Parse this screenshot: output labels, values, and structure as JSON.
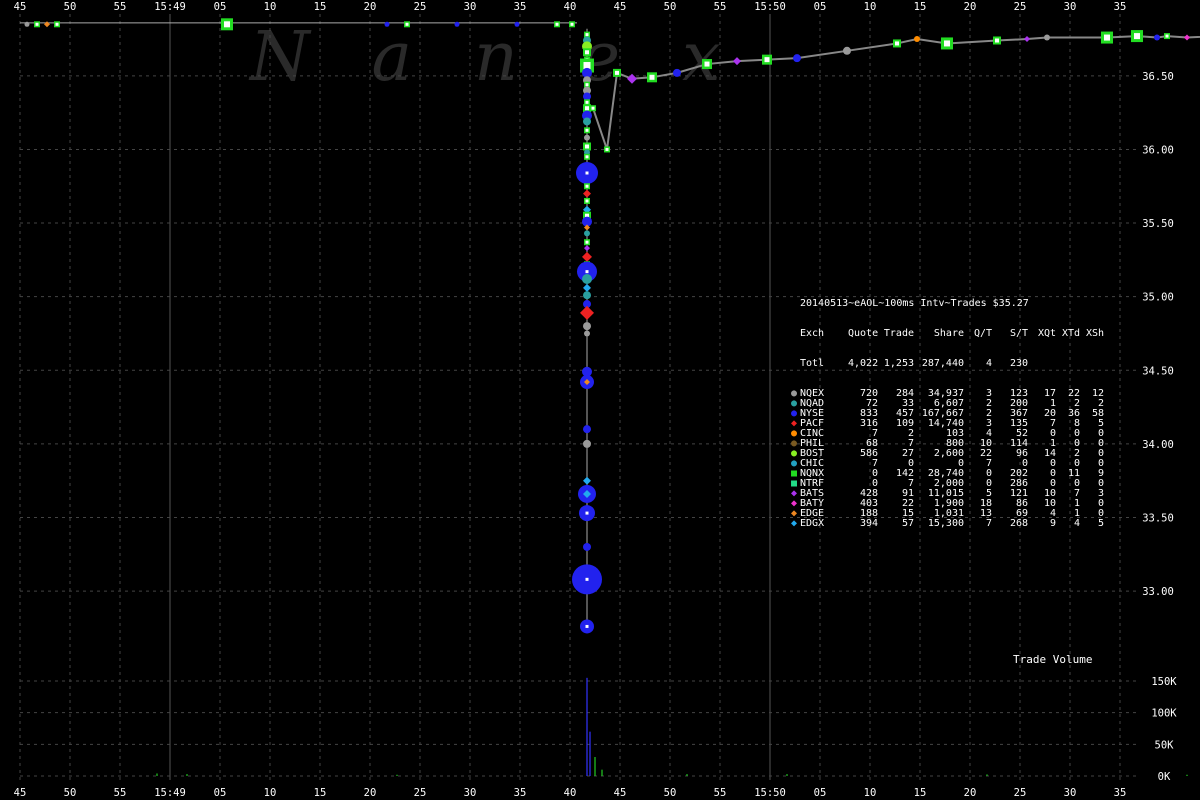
{
  "chart_data": {
    "type": "scatter",
    "title": "20140513~eAOL~100ms Intv~Trades $35.27",
    "watermark": "Nanex",
    "x_tick_labels": [
      "45",
      "50",
      "55",
      "15:49",
      "05",
      "10",
      "15",
      "20",
      "25",
      "30",
      "35",
      "40",
      "45",
      "50",
      "55",
      "15:50",
      "05",
      "10",
      "15",
      "20",
      "25",
      "30",
      "35"
    ],
    "y_price_ticks": [
      "36.50",
      "36.00",
      "35.50",
      "35.00",
      "34.50",
      "34.00",
      "33.50",
      "33.00"
    ],
    "y_price_range": [
      32.6,
      36.92
    ],
    "y_volume_ticks": [
      "150K",
      "100K",
      "50K",
      "0K"
    ],
    "volume_label": "Trade Volume",
    "grid": true,
    "legend_placement": "right-middle",
    "table": {
      "header": [
        "Exch",
        "Quote",
        "Trade",
        "Share",
        "Q/T",
        "S/T",
        "XQt",
        "XTd",
        "XSh"
      ],
      "totals": [
        "Totl",
        "4,022",
        "1,253",
        "287,440",
        "4",
        "230",
        "",
        "",
        ""
      ],
      "rows": [
        {
          "name": "NQEX",
          "color": "#9a9a9a",
          "marker": "circle",
          "values": [
            "720",
            "284",
            "34,937",
            "3",
            "123",
            "17",
            "22",
            "12"
          ]
        },
        {
          "name": "NQAD",
          "color": "#2aa0a0",
          "marker": "small-circle",
          "values": [
            "72",
            "33",
            "6,607",
            "2",
            "200",
            "1",
            "2",
            "2"
          ]
        },
        {
          "name": "NYSE",
          "color": "#2222ee",
          "marker": "big-circle",
          "values": [
            "833",
            "457",
            "167,667",
            "2",
            "367",
            "20",
            "36",
            "58"
          ]
        },
        {
          "name": "PACF",
          "color": "#ee2222",
          "marker": "diamond",
          "values": [
            "316",
            "109",
            "14,740",
            "3",
            "135",
            "7",
            "8",
            "5"
          ]
        },
        {
          "name": "CINC",
          "color": "#ff8c00",
          "marker": "circle",
          "values": [
            "7",
            "2",
            "103",
            "4",
            "52",
            "0",
            "0",
            "0"
          ]
        },
        {
          "name": "PHIL",
          "color": "#7a5a22",
          "marker": "circle",
          "values": [
            "68",
            "7",
            "800",
            "10",
            "114",
            "1",
            "0",
            "0"
          ]
        },
        {
          "name": "BOST",
          "color": "#88ee22",
          "marker": "big-circle",
          "values": [
            "586",
            "27",
            "2,600",
            "22",
            "96",
            "14",
            "2",
            "0"
          ]
        },
        {
          "name": "CHIC",
          "color": "#22a0c0",
          "marker": "circle",
          "values": [
            "7",
            "0",
            "0",
            "7",
            "0",
            "0",
            "0",
            "0"
          ]
        },
        {
          "name": "NQNX",
          "color": "#22dd22",
          "marker": "square",
          "values": [
            "0",
            "142",
            "28,740",
            "0",
            "202",
            "0",
            "11",
            "9"
          ]
        },
        {
          "name": "NTRF",
          "color": "#22dd88",
          "marker": "square",
          "values": [
            "0",
            "7",
            "2,000",
            "0",
            "286",
            "0",
            "0",
            "0"
          ]
        },
        {
          "name": "BATS",
          "color": "#aa33ee",
          "marker": "diamond",
          "values": [
            "428",
            "91",
            "11,015",
            "5",
            "121",
            "10",
            "7",
            "3"
          ]
        },
        {
          "name": "BATY",
          "color": "#ee33cc",
          "marker": "diamond",
          "values": [
            "403",
            "22",
            "1,900",
            "18",
            "86",
            "10",
            "1",
            "0"
          ]
        },
        {
          "name": "EDGE",
          "color": "#ee8822",
          "marker": "diamond",
          "values": [
            "188",
            "15",
            "1,031",
            "13",
            "69",
            "4",
            "1",
            "0"
          ]
        },
        {
          "name": "EDGX",
          "color": "#22aaee",
          "marker": "diamond",
          "values": [
            "394",
            "57",
            "15,300",
            "7",
            "268",
            "9",
            "4",
            "5"
          ]
        }
      ]
    },
    "trades_before": [
      {
        "t": -71,
        "p": 36.86,
        "ex": "NQNX",
        "s": 2
      },
      {
        "t": -62,
        "p": 36.86,
        "ex": "NQNX",
        "s": 2
      },
      {
        "t": -60,
        "p": 36.85,
        "ex": "EDGE",
        "s": 2
      },
      {
        "t": -59,
        "p": 36.85,
        "ex": "NQNX",
        "s": 3
      },
      {
        "t": -56,
        "p": 36.85,
        "ex": "NQEX",
        "s": 2
      },
      {
        "t": -55,
        "p": 36.85,
        "ex": "NQNX",
        "s": 3
      },
      {
        "t": -54,
        "p": 36.85,
        "ex": "EDGE",
        "s": 2
      },
      {
        "t": -53,
        "p": 36.85,
        "ex": "NQNX",
        "s": 2
      },
      {
        "t": -36,
        "p": 36.85,
        "ex": "NQNX",
        "s": 6
      },
      {
        "t": -20,
        "p": 36.85,
        "ex": "NYSE",
        "s": 2
      },
      {
        "t": -18,
        "p": 36.85,
        "ex": "NQNX",
        "s": 2
      },
      {
        "t": -13,
        "p": 36.85,
        "ex": "NYSE",
        "s": 2
      },
      {
        "t": -7,
        "p": 36.85,
        "ex": "NYSE",
        "s": 2
      },
      {
        "t": -3,
        "p": 36.85,
        "ex": "NQNX",
        "s": 3
      },
      {
        "t": -1.5,
        "p": 36.85,
        "ex": "NQNX",
        "s": 3
      }
    ],
    "crash_column": [
      {
        "p": 36.78,
        "ex": "NQNX",
        "s": 3
      },
      {
        "p": 36.74,
        "ex": "NQAD",
        "s": 4
      },
      {
        "p": 36.7,
        "ex": "BOST",
        "s": 5
      },
      {
        "p": 36.66,
        "ex": "NQNX",
        "s": 4
      },
      {
        "p": 36.61,
        "ex": "NQNX",
        "s": 3
      },
      {
        "p": 36.57,
        "ex": "NQNX",
        "s": 7
      },
      {
        "p": 36.52,
        "ex": "NYSE",
        "s": 5
      },
      {
        "p": 36.47,
        "ex": "NQEX",
        "s": 4
      },
      {
        "p": 36.44,
        "ex": "NQNX",
        "s": 3
      },
      {
        "p": 36.4,
        "ex": "NQEX",
        "s": 4
      },
      {
        "p": 36.36,
        "ex": "NYSE",
        "s": 4
      },
      {
        "p": 36.32,
        "ex": "NQNX",
        "s": 3
      },
      {
        "p": 36.28,
        "ex": "NQNX",
        "s": 4
      },
      {
        "p": 36.23,
        "ex": "NYSE",
        "s": 5
      },
      {
        "p": 36.19,
        "ex": "NQAD",
        "s": 4
      },
      {
        "p": 36.13,
        "ex": "NQNX",
        "s": 3
      },
      {
        "p": 36.08,
        "ex": "NQEX",
        "s": 3
      },
      {
        "p": 36.02,
        "ex": "NQNX",
        "s": 4
      },
      {
        "p": 35.98,
        "ex": "NQAD",
        "s": 3
      },
      {
        "p": 35.95,
        "ex": "NQNX",
        "s": 3
      },
      {
        "p": 35.84,
        "ex": "NYSE",
        "s": 11
      },
      {
        "p": 35.75,
        "ex": "NQNX",
        "s": 3
      },
      {
        "p": 35.7,
        "ex": "PACF",
        "s": 4
      },
      {
        "p": 35.65,
        "ex": "NQNX",
        "s": 3
      },
      {
        "p": 35.59,
        "ex": "EDGX",
        "s": 4
      },
      {
        "p": 35.55,
        "ex": "NQNX",
        "s": 4
      },
      {
        "p": 35.51,
        "ex": "NYSE",
        "s": 5
      },
      {
        "p": 35.47,
        "ex": "EDGE",
        "s": 3
      },
      {
        "p": 35.43,
        "ex": "NQAD",
        "s": 3
      },
      {
        "p": 35.37,
        "ex": "NQNX",
        "s": 3
      },
      {
        "p": 35.33,
        "ex": "BATS",
        "s": 3
      },
      {
        "p": 35.27,
        "ex": "PACF",
        "s": 5
      },
      {
        "p": 35.22,
        "ex": "NQNX",
        "s": 3
      },
      {
        "p": 35.17,
        "ex": "NYSE",
        "s": 10
      },
      {
        "p": 35.12,
        "ex": "NQAD",
        "s": 5
      },
      {
        "p": 35.06,
        "ex": "EDGX",
        "s": 4
      },
      {
        "p": 35.01,
        "ex": "NQAD",
        "s": 4
      },
      {
        "p": 34.95,
        "ex": "NYSE",
        "s": 4
      },
      {
        "p": 34.89,
        "ex": "PACF",
        "s": 7
      },
      {
        "p": 34.8,
        "ex": "NQEX",
        "s": 4
      },
      {
        "p": 34.75,
        "ex": "NQEX",
        "s": 3
      },
      {
        "p": 34.49,
        "ex": "NYSE",
        "s": 5
      },
      {
        "p": 34.42,
        "ex": "NYSE",
        "s": 7
      },
      {
        "p": 34.42,
        "ex": "EDGE",
        "s": 3
      },
      {
        "p": 34.1,
        "ex": "NYSE",
        "s": 4
      },
      {
        "p": 34.0,
        "ex": "NQEX",
        "s": 4
      },
      {
        "p": 33.75,
        "ex": "EDGX",
        "s": 4
      },
      {
        "p": 33.66,
        "ex": "NYSE",
        "s": 9
      },
      {
        "p": 33.66,
        "ex": "EDGX",
        "s": 4
      },
      {
        "p": 33.53,
        "ex": "NYSE",
        "s": 8
      },
      {
        "p": 33.3,
        "ex": "NYSE",
        "s": 4
      },
      {
        "p": 33.08,
        "ex": "NYSE",
        "s": 15
      },
      {
        "p": 32.76,
        "ex": "NYSE",
        "s": 7
      }
    ],
    "trades_after": [
      {
        "t": 0.6,
        "p": 36.28,
        "ex": "NQNX",
        "s": 3
      },
      {
        "t": 2.0,
        "p": 36.0,
        "ex": "NQNX",
        "s": 3
      },
      {
        "t": 3.0,
        "p": 36.52,
        "ex": "NQNX",
        "s": 4
      },
      {
        "t": 4.5,
        "p": 36.48,
        "ex": "BATS",
        "s": 5
      },
      {
        "t": 6.5,
        "p": 36.49,
        "ex": "NQNX",
        "s": 5
      },
      {
        "t": 9,
        "p": 36.52,
        "ex": "NYSE",
        "s": 4
      },
      {
        "t": 12,
        "p": 36.58,
        "ex": "NQNX",
        "s": 5
      },
      {
        "t": 15,
        "p": 36.6,
        "ex": "BATS",
        "s": 4
      },
      {
        "t": 18,
        "p": 36.61,
        "ex": "NQNX",
        "s": 5
      },
      {
        "t": 21,
        "p": 36.62,
        "ex": "NYSE",
        "s": 4
      },
      {
        "t": 26,
        "p": 36.67,
        "ex": "NQEX",
        "s": 4
      },
      {
        "t": 31,
        "p": 36.72,
        "ex": "NQNX",
        "s": 4
      },
      {
        "t": 33,
        "p": 36.75,
        "ex": "CINC",
        "s": 3
      },
      {
        "t": 36,
        "p": 36.72,
        "ex": "NQNX",
        "s": 6
      },
      {
        "t": 41,
        "p": 36.74,
        "ex": "NQNX",
        "s": 4
      },
      {
        "t": 44,
        "p": 36.75,
        "ex": "BATS",
        "s": 3
      },
      {
        "t": 46,
        "p": 36.76,
        "ex": "NQEX",
        "s": 3
      },
      {
        "t": 52,
        "p": 36.76,
        "ex": "NQNX",
        "s": 6
      },
      {
        "t": 55,
        "p": 36.77,
        "ex": "NQNX",
        "s": 6
      },
      {
        "t": 57,
        "p": 36.76,
        "ex": "NYSE",
        "s": 3
      },
      {
        "t": 58,
        "p": 36.77,
        "ex": "NQNX",
        "s": 3
      },
      {
        "t": 60,
        "p": 36.76,
        "ex": "BATY",
        "s": 3
      },
      {
        "t": 66,
        "p": 36.78,
        "ex": "NQEX",
        "s": 4
      },
      {
        "t": 72,
        "p": 36.79,
        "ex": "NQNX",
        "s": 4
      },
      {
        "t": 75,
        "p": 36.81,
        "ex": "NQNX",
        "s": 3
      },
      {
        "t": 79,
        "p": 36.81,
        "ex": "NYSE",
        "s": 5
      },
      {
        "t": 83,
        "p": 36.81,
        "ex": "NQEX",
        "s": 4
      },
      {
        "t": 85,
        "p": 36.82,
        "ex": "NQNX",
        "s": 6
      },
      {
        "t": 87,
        "p": 36.81,
        "ex": "NYSE",
        "s": 3
      },
      {
        "t": 91,
        "p": 36.82,
        "ex": "BATY",
        "s": 3
      },
      {
        "t": 94,
        "p": 36.82,
        "ex": "NQNX",
        "s": 4
      },
      {
        "t": 104,
        "p": 36.83,
        "ex": "NQNX",
        "s": 9
      },
      {
        "t": 108,
        "p": 36.85,
        "ex": "NQNX",
        "s": 5
      },
      {
        "t": 112,
        "p": 36.85,
        "ex": "NQNX",
        "s": 4
      }
    ],
    "volume_bars": [
      {
        "t": -43,
        "v": 4000
      },
      {
        "t": -40,
        "v": 3000
      },
      {
        "t": -19,
        "v": 2000
      },
      {
        "t": 0,
        "v": 155000
      },
      {
        "t": 0.3,
        "v": 70000
      },
      {
        "t": 0.8,
        "v": 30000
      },
      {
        "t": 1.5,
        "v": 10000
      },
      {
        "t": 10,
        "v": 3000
      },
      {
        "t": 20,
        "v": 3000
      },
      {
        "t": 40,
        "v": 2500
      },
      {
        "t": 60,
        "v": 2000
      },
      {
        "t": 95,
        "v": 6000
      },
      {
        "t": 106,
        "v": 4000
      }
    ],
    "volume_max": 180000
  }
}
